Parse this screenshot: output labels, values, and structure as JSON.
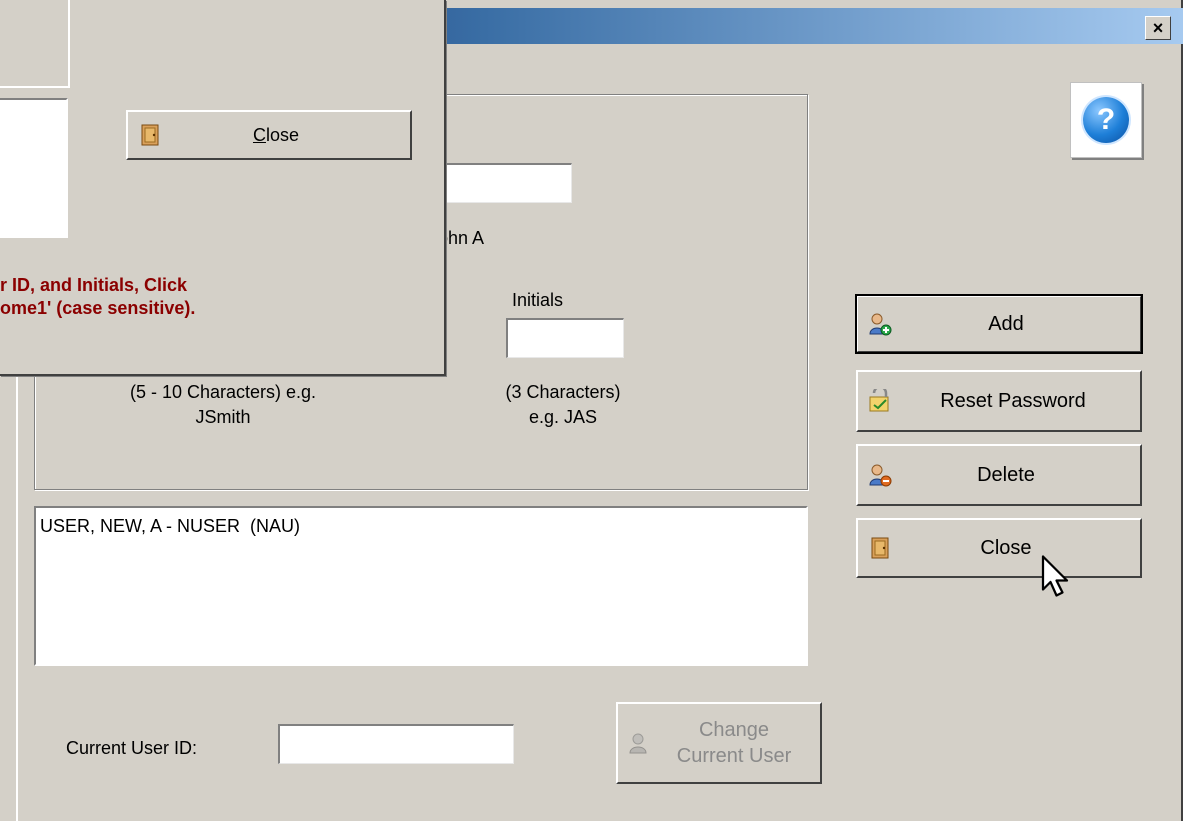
{
  "main_window": {
    "title": "",
    "title_close_glyph": "×",
    "name_preview_fragment": "ohn A",
    "initials_label": "Initials",
    "userid_hint_line1": "(5 - 10 Characters) e.g.",
    "userid_hint_line2": "JSmith",
    "initials_hint_line1": "(3 Characters)",
    "initials_hint_line2": "e.g. JAS",
    "user_list": [
      "USER, NEW, A - NUSER  (NAU)"
    ],
    "current_user_label": "Current User ID:",
    "current_user_value": "",
    "change_user_button": {
      "line1": "Change",
      "line2": "Current User",
      "enabled": false
    },
    "buttons": {
      "add": "Add",
      "reset_password": "Reset Password",
      "delete": "Delete",
      "close": "Close"
    },
    "help_glyph": "?"
  },
  "popup": {
    "close_button": {
      "mnemonic": "C",
      "rest": "lose"
    },
    "instruction_line1": "r ID, and Initials, Click",
    "instruction_line2": "ome1' (case sensitive)."
  },
  "colors": {
    "dialog_bg": "#d4d0c8",
    "titlebar_start": "#0a246a",
    "titlebar_end": "#a6caf0",
    "warning_text": "#8b0000",
    "help_icon": "#1e7fd8"
  },
  "icons": [
    "help-icon",
    "user-add-icon",
    "key-certificate-icon",
    "user-delete-icon",
    "door-icon",
    "user-switch-icon",
    "mouse-cursor-icon"
  ]
}
